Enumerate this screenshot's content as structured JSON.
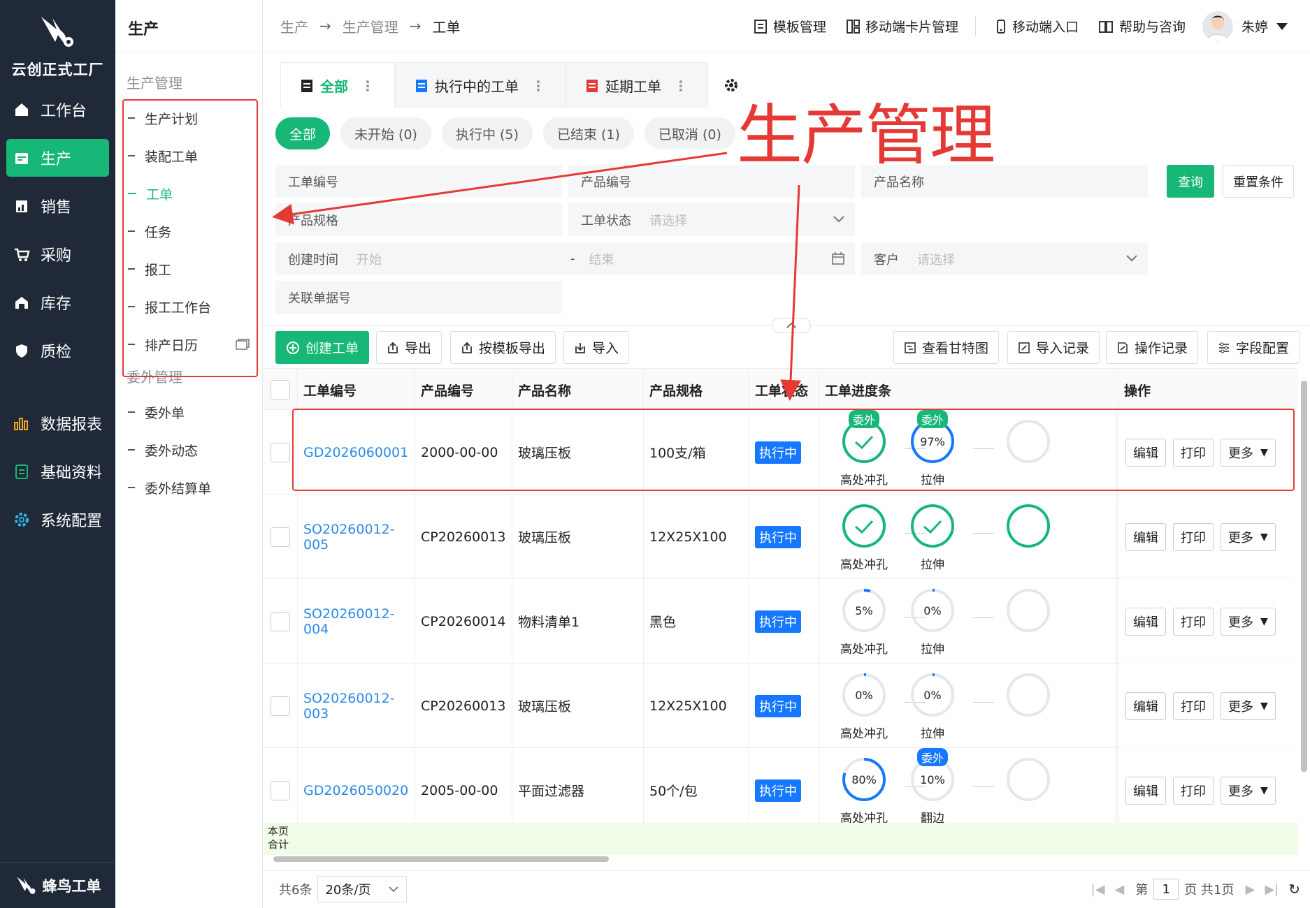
{
  "sidebar": {
    "app_name": "云创正式工厂",
    "items": [
      {
        "label": "工作台",
        "icon": "home-icon"
      },
      {
        "label": "生产",
        "icon": "calendar-icon"
      },
      {
        "label": "销售",
        "icon": "sales-icon"
      },
      {
        "label": "采购",
        "icon": "cart-icon"
      },
      {
        "label": "库存",
        "icon": "warehouse-icon"
      },
      {
        "label": "质检",
        "icon": "shield-icon"
      },
      {
        "label": "数据报表",
        "icon": "bar-chart-icon"
      },
      {
        "label": "基础资料",
        "icon": "document-icon"
      },
      {
        "label": "系统配置",
        "icon": "gear-icon"
      }
    ],
    "footer": "蜂鸟工单",
    "accent": "#16b777"
  },
  "subside": {
    "title": "生产",
    "group1": "生产管理",
    "group1_items": [
      "生产计划",
      "装配工单",
      "工单",
      "任务",
      "报工",
      "报工工作台",
      "排产日历"
    ],
    "group2": "委外管理",
    "group2_items": [
      "委外单",
      "委外动态",
      "委外结算单"
    ]
  },
  "breadcrumb": [
    "生产",
    "生产管理",
    "工单"
  ],
  "topbar": {
    "links": [
      "模板管理",
      "移动端卡片管理",
      "移动端入口",
      "帮助与咨询"
    ],
    "user": "朱婷"
  },
  "tabs": [
    "全部",
    "执行中的工单",
    "延期工单"
  ],
  "pills": [
    "全部",
    "未开始 (0)",
    "执行中 (5)",
    "已结束 (1)",
    "已取消 (0)"
  ],
  "filters": {
    "order_no": "工单编号",
    "product_no": "产品编号",
    "product_name": "产品名称",
    "spec": "产品规格",
    "status_label": "工单状态",
    "status_ph": "请选择",
    "created_label": "创建时间",
    "start_ph": "开始",
    "end_ph": "结束",
    "dash": "-",
    "customer_label": "客户",
    "customer_ph": "请选择",
    "related": "关联单据号",
    "query": "查询",
    "reset": "重置条件"
  },
  "annotation": "生产管理",
  "toolbar": {
    "create": "创建工单",
    "export": "导出",
    "export_tpl": "按模板导出",
    "import": "导入",
    "gantt": "查看甘特图",
    "import_log": "导入记录",
    "op_log": "操作记录",
    "fields": "字段配置"
  },
  "table": {
    "headers": [
      "工单编号",
      "产品编号",
      "产品名称",
      "产品规格",
      "工单状态",
      "工单进度条",
      "操作"
    ],
    "rows": [
      {
        "no": "GD2026060001",
        "pno": "2000-00-00",
        "pname": "玻璃压板",
        "spec": "100支/箱",
        "status": "执行中",
        "p1": {
          "val": "",
          "done": true,
          "pct": 1.0,
          "name": "高处冲孔",
          "badge": "委外",
          "badge_color": "#16b777"
        },
        "p2": {
          "val": "97%",
          "done": false,
          "pct": 0.97,
          "name": "拉伸",
          "badge": "委外",
          "badge_color": "#16b777"
        }
      },
      {
        "no": "SO20260012-005",
        "pno": "CP20260013",
        "pname": "玻璃压板",
        "spec": "12X25X100",
        "status": "执行中",
        "p1": {
          "val": "",
          "done": true,
          "pct": 1.0,
          "name": "高处冲孔",
          "badge": "",
          "badge_color": ""
        },
        "p2": {
          "val": "",
          "done": true,
          "pct": 1.0,
          "name": "拉伸",
          "badge": "",
          "badge_color": ""
        }
      },
      {
        "no": "SO20260012-004",
        "pno": "CP20260014",
        "pname": "物料清单1",
        "spec": "黑色",
        "status": "执行中",
        "p1": {
          "val": "5%",
          "done": false,
          "pct": 0.05,
          "name": "高处冲孔",
          "badge": "",
          "badge_color": ""
        },
        "p2": {
          "val": "0%",
          "done": false,
          "pct": 0.0,
          "name": "拉伸",
          "badge": "",
          "badge_color": ""
        }
      },
      {
        "no": "SO20260012-003",
        "pno": "CP20260013",
        "pname": "玻璃压板",
        "spec": "12X25X100",
        "status": "执行中",
        "p1": {
          "val": "0%",
          "done": false,
          "pct": 0.0,
          "name": "高处冲孔",
          "badge": "",
          "badge_color": ""
        },
        "p2": {
          "val": "0%",
          "done": false,
          "pct": 0.0,
          "name": "拉伸",
          "badge": "",
          "badge_color": ""
        }
      },
      {
        "no": "GD2026050020",
        "pno": "2005-00-00",
        "pname": "平面过滤器",
        "spec": "50个/包",
        "status": "执行中",
        "p1": {
          "val": "80%",
          "done": false,
          "pct": 0.8,
          "name": "高处冲孔",
          "badge": "",
          "badge_color": ""
        },
        "p2": {
          "val": "10%",
          "done": false,
          "pct": 0.1,
          "name": "翻边",
          "badge": "委外",
          "badge_color": "#1677ff"
        }
      }
    ],
    "actions": [
      "编辑",
      "打印",
      "更多"
    ],
    "summary": "本页\n合计"
  },
  "pager": {
    "total": "共6条",
    "size": "20条/页",
    "page_prefix": "第",
    "page": "1",
    "page_suffix": "页 共1页"
  }
}
